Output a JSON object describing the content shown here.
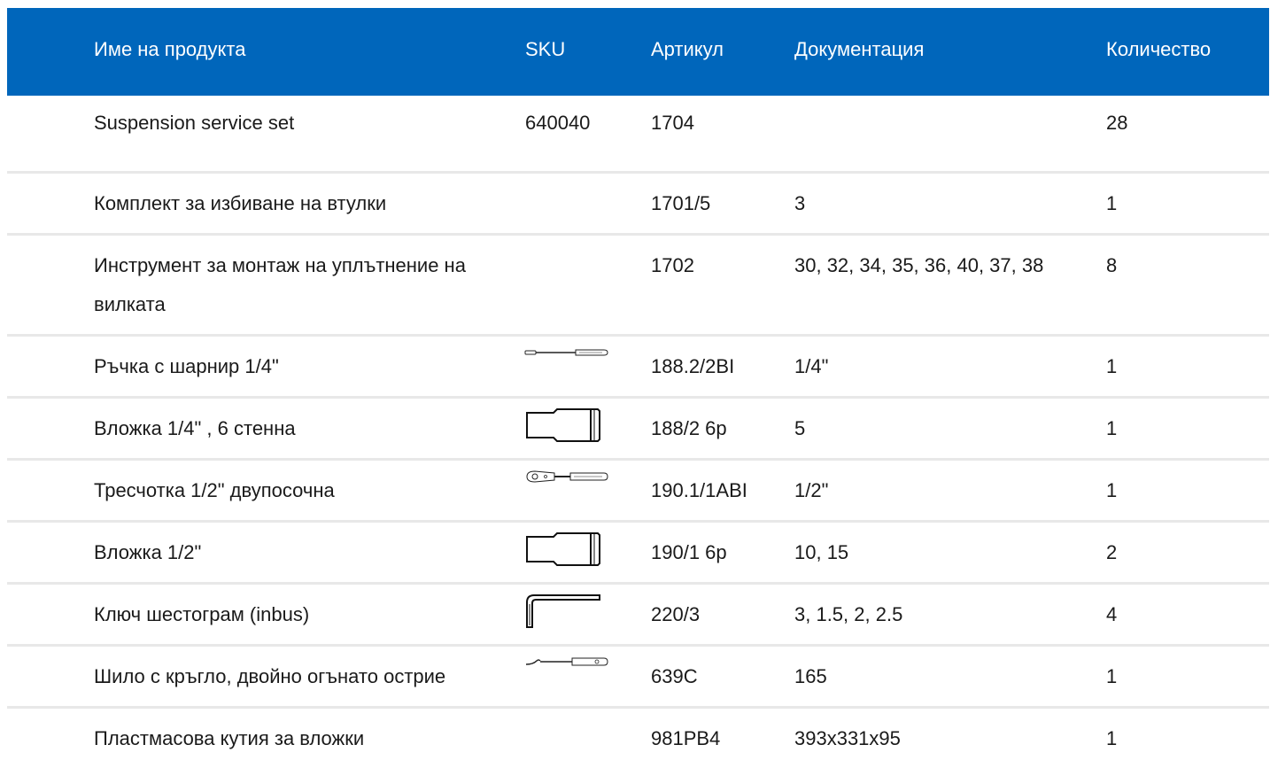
{
  "header": {
    "name": "Име на продукта",
    "sku": "SKU",
    "article": "Артикул",
    "docs": "Документация",
    "qty": "Количество"
  },
  "rows": [
    {
      "name": "Suspension service set",
      "sku": "640040",
      "article": "1704",
      "docs": "",
      "qty": "28",
      "icon": ""
    },
    {
      "name": "Комплект за избиване на втулки",
      "sku": "",
      "article": "1701/5",
      "docs": "3",
      "qty": "1",
      "icon": ""
    },
    {
      "name": "Инструмент за монтаж на уплътнение на вилката",
      "sku": "",
      "article": "1702",
      "docs": "30, 32, 34, 35, 36, 40, 37, 38",
      "qty": "8",
      "icon": ""
    },
    {
      "name": "Ръчка с шарнир 1/4\"",
      "sku": "",
      "article": "188.2/2BI",
      "docs": "1/4\"",
      "qty": "1",
      "icon": "hinge-handle-icon"
    },
    {
      "name": "Вложка 1/4\" , 6 стенна",
      "sku": "",
      "article": "188/2 6p",
      "docs": "5",
      "qty": "1",
      "icon": "socket-icon"
    },
    {
      "name": "Тресчотка 1/2\" двупосочна",
      "sku": "",
      "article": "190.1/1ABI",
      "docs": "1/2\"",
      "qty": "1",
      "icon": "ratchet-icon"
    },
    {
      "name": "Вложка 1/2\"",
      "sku": "",
      "article": "190/1 6p",
      "docs": "10, 15",
      "qty": "2",
      "icon": "socket-icon"
    },
    {
      "name": "Ключ шестограм (inbus)",
      "sku": "",
      "article": "220/3",
      "docs": "3, 1.5, 2, 2.5",
      "qty": "4",
      "icon": "hex-key-icon"
    },
    {
      "name": "Шило с кръгло, двойно огънато острие",
      "sku": "",
      "article": "639C",
      "docs": "165",
      "qty": "1",
      "icon": "awl-icon"
    },
    {
      "name": "Пластмасова кутия за вложки",
      "sku": "",
      "article": "981PB4",
      "docs": "393x331x95",
      "qty": "1",
      "icon": ""
    }
  ]
}
